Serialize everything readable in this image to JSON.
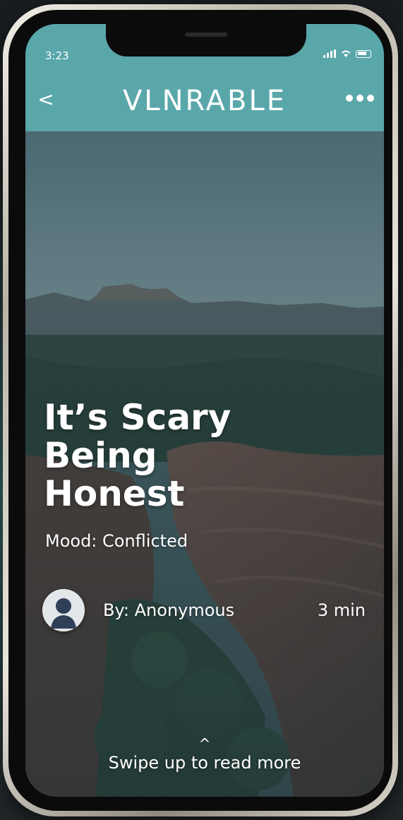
{
  "status_bar": {
    "time": "3:23",
    "icons": [
      "signal-icon",
      "wifi-icon",
      "battery-icon"
    ]
  },
  "header": {
    "back_label": "<",
    "logo": "VLNRABLE",
    "more_icon": "more-dots-icon",
    "background_color": "#5aa7aa"
  },
  "story": {
    "title": "It’s Scary\nBeing\nHonest",
    "mood": "Mood: Conflicted",
    "author": "By: Anonymous",
    "read_time": "3 min",
    "avatar_icon": "user-avatar-icon",
    "background": "canyon-landscape-photo"
  },
  "footer": {
    "caret": "^",
    "swipe_label": "Swipe up to read more"
  }
}
